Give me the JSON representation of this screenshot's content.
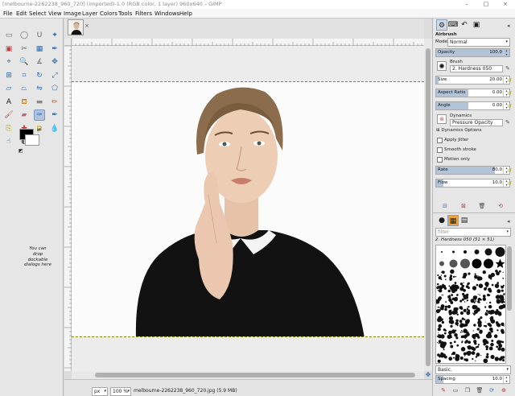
{
  "window": {
    "title": "[melbourne-2262238_960_720] (imported)-1.0 (RGB color, 1 layer) 960x640 – GIMP",
    "minimize": "–",
    "maximize": "□",
    "close": "×"
  },
  "menubar": [
    "File",
    "Edit",
    "Select",
    "View",
    "Image",
    "Layer",
    "Colors",
    "Tools",
    "Filters",
    "Windows",
    "Help"
  ],
  "toolbox": {
    "tools": [
      "rect-select-icon",
      "ellipse-select-icon",
      "lasso-icon",
      "fuzzy-select-icon",
      "color-select-icon",
      "scissors-icon",
      "foreground-select-icon",
      "paths-icon",
      "color-picker-icon",
      "zoom-icon",
      "measure-icon",
      "move-icon",
      "align-icon",
      "crop-icon",
      "rotate-icon",
      "scale-icon",
      "shear-icon",
      "perspective-icon",
      "flip-icon",
      "cage-icon",
      "text-icon",
      "bucket-fill-icon",
      "blend-icon",
      "pencil-icon",
      "paintbrush-icon",
      "eraser-icon",
      "airbrush-icon",
      "ink-icon",
      "clone-icon",
      "heal-icon",
      "perspective-clone-icon",
      "blur-icon",
      "smudge-icon",
      "dodge-burn-icon"
    ],
    "selected_tool": "airbrush-icon",
    "foreground_color": "#000000",
    "background_color": "#ffffff",
    "drop_hint": "You can drop dockable dialogs here"
  },
  "image_tab": {
    "close": "×"
  },
  "status": {
    "unit": "px",
    "zoom": "100 %",
    "filename": "melbourne-2262238_960_720.jpg (5.9 MB)"
  },
  "dock": {
    "tool_title": "Airbrush",
    "mode_label": "Mode",
    "mode_value": "Normal",
    "opacity": {
      "label": "Opacity",
      "value": "100.0",
      "fraction": 1.0
    },
    "brush_label": "Brush",
    "brush_value": "2. Hardness 050",
    "size": {
      "label": "Size",
      "value": "20.00"
    },
    "aspect": {
      "label": "Aspect Ratio",
      "value": "0.00"
    },
    "angle": {
      "label": "Angle",
      "value": "0.00"
    },
    "dynamics_label": "Dynamics",
    "dynamics_value": "Pressure Opacity",
    "dynamics_options": "Dynamics Options",
    "apply_jitter": "Apply Jitter",
    "smooth_stroke": "Smooth stroke",
    "motion_only": "Motion only",
    "rate": {
      "label": "Rate",
      "value": "80.0",
      "fraction": 0.8
    },
    "flow": {
      "label": "Flow",
      "value": "10.0",
      "fraction": 0.1
    },
    "filter_placeholder": "filter",
    "brush_name": "2. Hardness 050 (51 × 51)",
    "basic": "Basic.",
    "spacing": {
      "label": "Spacing",
      "value": "10.0"
    }
  },
  "colors": {
    "accent": "#b3c3d8",
    "selection": "#b0c4de",
    "canvas_bg": "#ececec"
  }
}
